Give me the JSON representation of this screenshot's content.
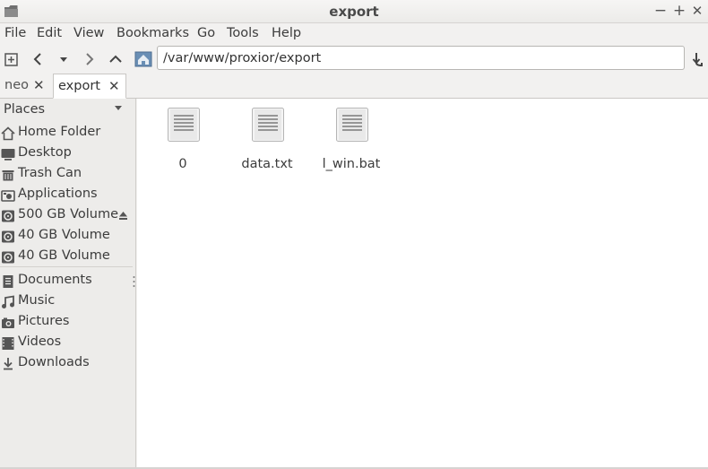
{
  "window": {
    "title": "export",
    "controls": {
      "minimize": "−",
      "maximize": "+",
      "close": "✕"
    }
  },
  "menubar": {
    "items": [
      "File",
      "Edit",
      "View",
      "Bookmarks",
      "Go",
      "Tools",
      "Help"
    ]
  },
  "toolbar": {
    "location": "/var/www/proxior/export",
    "icons": [
      "new-tab-icon",
      "back-icon",
      "history-dropdown-icon",
      "forward-icon",
      "up-icon",
      "home-location-icon",
      "go-icon"
    ]
  },
  "tabs": [
    {
      "label": "neo",
      "active": false
    },
    {
      "label": "export",
      "active": true
    }
  ],
  "sidebar": {
    "header": "Places",
    "items": [
      {
        "label": "Home Folder",
        "icon": "home-icon"
      },
      {
        "label": "Desktop",
        "icon": "desktop-icon"
      },
      {
        "label": "Trash Can",
        "icon": "trash-icon"
      },
      {
        "label": "Applications",
        "icon": "applications-icon"
      },
      {
        "label": "500 GB Volume",
        "icon": "drive-icon",
        "ejectable": true
      },
      {
        "label": "40 GB Volume",
        "icon": "drive-icon"
      },
      {
        "label": "40 GB Volume",
        "icon": "drive-icon"
      }
    ],
    "bookmarks": [
      {
        "label": "Documents",
        "icon": "documents-icon"
      },
      {
        "label": "Music",
        "icon": "music-icon"
      },
      {
        "label": "Pictures",
        "icon": "pictures-icon"
      },
      {
        "label": "Videos",
        "icon": "videos-icon"
      },
      {
        "label": "Downloads",
        "icon": "downloads-icon"
      }
    ]
  },
  "files": [
    {
      "name": "0",
      "icon": "text-file-icon"
    },
    {
      "name": "data.txt",
      "icon": "text-file-icon"
    },
    {
      "name": "l_win.bat",
      "icon": "text-file-icon"
    }
  ]
}
